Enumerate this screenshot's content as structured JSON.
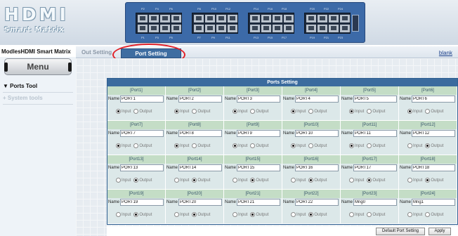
{
  "logo": {
    "line1": "HDMI",
    "line2": "Smart Matrix"
  },
  "panel": {
    "port_labels_top": [
      "P2",
      "P4",
      "P6",
      "P8",
      "P10",
      "P12",
      "P14",
      "P16",
      "P18",
      "P20",
      "P22",
      "P24"
    ],
    "port_labels_bottom": [
      "P1",
      "P3",
      "P5",
      "P7",
      "P9",
      "P11",
      "P13",
      "P15",
      "P17",
      "P19",
      "P21",
      "P23"
    ]
  },
  "breadcrumb": "ModlesHDMI Smart Matrix",
  "tabs": [
    {
      "label": "Out Setting"
    },
    {
      "label": "Port Setting",
      "active": true
    }
  ],
  "blank_link": "blank",
  "sidebar": {
    "menu_label": "Menu",
    "items": [
      {
        "label": "Ports Tool",
        "icon": "triangle-down-icon"
      },
      {
        "label": "System tools",
        "icon": "plus-icon"
      }
    ]
  },
  "ports_table": {
    "title": "Ports Setting",
    "name_label": "Name",
    "input_label": "Input",
    "output_label": "Output",
    "ports": [
      {
        "header": "[Port1]",
        "name": "PORT1",
        "mode": "input"
      },
      {
        "header": "[Port2]",
        "name": "PORT2",
        "mode": "input"
      },
      {
        "header": "[Port3]",
        "name": "PORT3",
        "mode": "input"
      },
      {
        "header": "[Port4]",
        "name": "PORT4",
        "mode": "input"
      },
      {
        "header": "[Port5]",
        "name": "PORT5",
        "mode": "input"
      },
      {
        "header": "[Port6]",
        "name": "PORT6",
        "mode": "input"
      },
      {
        "header": "[Port7]",
        "name": "PORT7",
        "mode": "input"
      },
      {
        "header": "[Port8]",
        "name": "PORT8",
        "mode": "input"
      },
      {
        "header": "[Port9]",
        "name": "PORT9",
        "mode": "input"
      },
      {
        "header": "[Port10]",
        "name": "PORT10",
        "mode": "input"
      },
      {
        "header": "[Port11]",
        "name": "PORT11",
        "mode": "input"
      },
      {
        "header": "[Port12]",
        "name": "PORT12",
        "mode": "output"
      },
      {
        "header": "[Port13]",
        "name": "PORT13",
        "mode": "output"
      },
      {
        "header": "[Port14]",
        "name": "PORT14",
        "mode": "output"
      },
      {
        "header": "[Port15]",
        "name": "PORT15",
        "mode": "output"
      },
      {
        "header": "[Port16]",
        "name": "PORT16",
        "mode": "output"
      },
      {
        "header": "[Port17]",
        "name": "PORT17",
        "mode": "output"
      },
      {
        "header": "[Port18]",
        "name": "PORT18",
        "mode": "output"
      },
      {
        "header": "[Port19]",
        "name": "PORT19",
        "mode": "output"
      },
      {
        "header": "[Port20]",
        "name": "PORT20",
        "mode": "output"
      },
      {
        "header": "[Port21]",
        "name": "PORT21",
        "mode": "output"
      },
      {
        "header": "[Port22]",
        "name": "PORT22",
        "mode": "output"
      },
      {
        "header": "[Port23]",
        "name": "Mng0",
        "mode": "none"
      },
      {
        "header": "[Port24]",
        "name": "Mng1",
        "mode": "none"
      }
    ]
  },
  "buttons": {
    "default_label": "Default Port Setting",
    "apply_label": "Apply"
  },
  "colors": {
    "accent": "#3b6b9e",
    "highlight_oval": "#e21f26"
  }
}
